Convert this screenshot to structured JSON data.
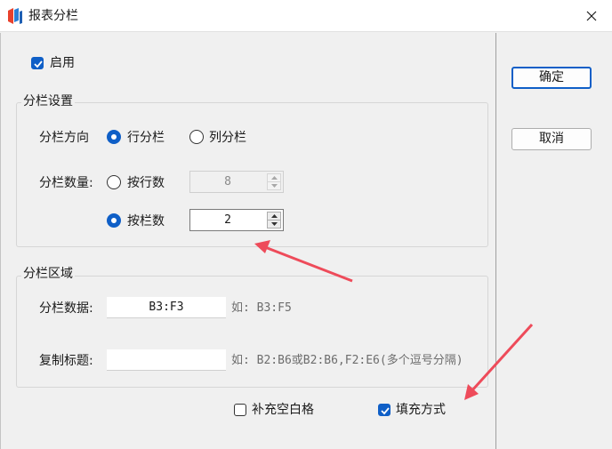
{
  "window": {
    "title": "报表分栏",
    "icon": "report-app-icon"
  },
  "enable": {
    "label": "启用",
    "checked": true
  },
  "column_settings": {
    "title": "分栏设置",
    "direction_label": "分栏方向",
    "direction_options": [
      {
        "label": "行分栏",
        "selected": true
      },
      {
        "label": "列分栏",
        "selected": false
      }
    ],
    "count_label": "分栏数量:",
    "by_rows": {
      "label": "按行数",
      "selected": false,
      "value": "8",
      "enabled": false
    },
    "by_columns": {
      "label": "按栏数",
      "selected": true,
      "value": "2",
      "enabled": true
    }
  },
  "column_area": {
    "title": "分栏区域",
    "data_label": "分栏数据:",
    "data_value": "B3:F3",
    "data_hint": "如: B3:F5",
    "title_label": "复制标题:",
    "title_value": "",
    "title_hint": "如: B2:B6或B2:B6,F2:E6(多个逗号分隔)"
  },
  "options": {
    "fill_blank": {
      "label": "补充空白格",
      "checked": false
    },
    "fill_mode": {
      "label": "填充方式",
      "checked": true
    }
  },
  "buttons": {
    "ok": "确定",
    "cancel": "取消"
  },
  "colors": {
    "accent": "#0f5fc7",
    "annotation_arrow": "#ee4b5a"
  }
}
